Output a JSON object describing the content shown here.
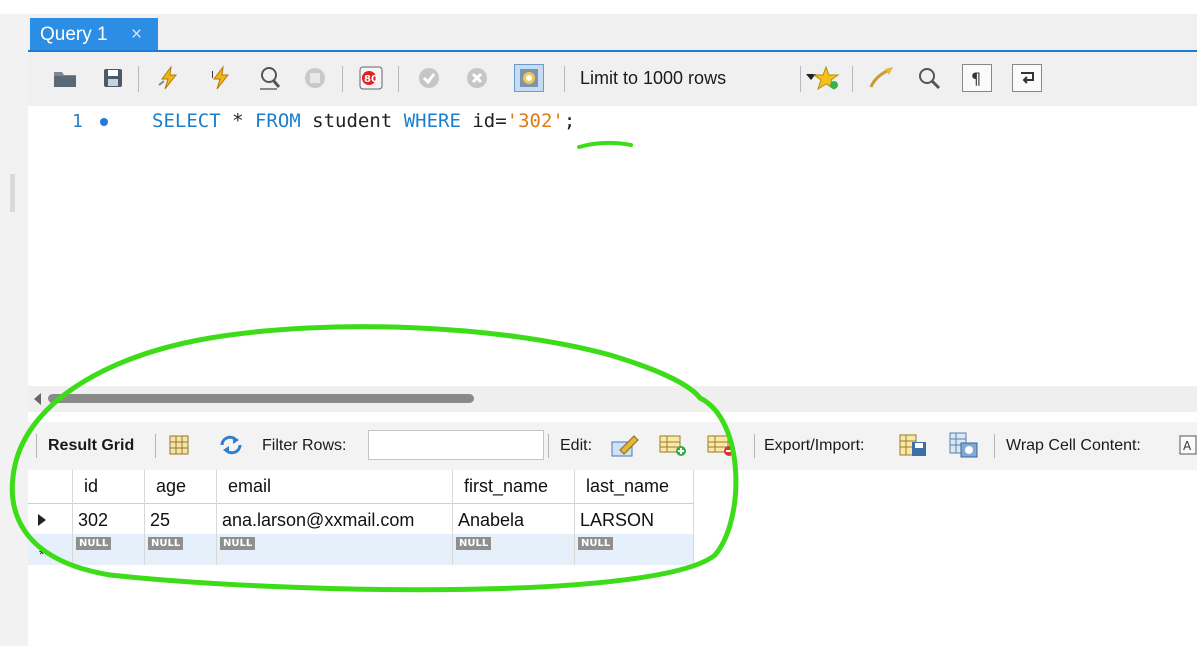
{
  "tab": {
    "title": "Query 1",
    "close": "×"
  },
  "toolbar": {
    "limit_label": "Limit to 1000 rows",
    "icons": [
      "open-folder-icon",
      "save-icon",
      "execute-icon",
      "execute-current-icon",
      "explain-icon",
      "stop-icon",
      "toggle-error-icon",
      "commit-icon",
      "rollback-icon",
      "autocommit-icon",
      "favorite-icon",
      "beautify-icon",
      "find-icon",
      "invisible-chars-icon",
      "wrap-icon"
    ]
  },
  "editor": {
    "line_number": "1",
    "kw_select": "SELECT",
    "star": " * ",
    "kw_from": "FROM",
    "table": " student ",
    "kw_where": "WHERE",
    "cond": " id=",
    "value": "'302'",
    "semicolon": ";"
  },
  "result_toolbar": {
    "result_grid": "Result Grid",
    "filter_rows": "Filter Rows:",
    "edit": "Edit:",
    "export_import": "Export/Import:",
    "wrap_cell": "Wrap Cell Content:"
  },
  "grid": {
    "columns": [
      "id",
      "age",
      "email",
      "first_name",
      "last_name"
    ],
    "row": [
      "302",
      "25",
      "ana.larson@xxmail.com",
      "Anabela",
      "LARSON"
    ],
    "null_label": "NULL"
  },
  "colors": {
    "tab_blue": "#2b8de3",
    "keyword": "#1b7fcf",
    "string": "#e07b17",
    "annotation_green": "#3ddc18"
  }
}
